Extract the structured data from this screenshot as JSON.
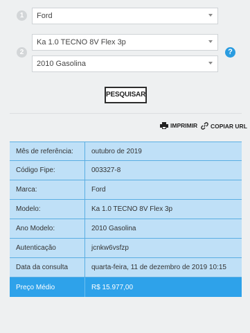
{
  "steps": [
    "1",
    "2"
  ],
  "selects": {
    "marca": "Ford",
    "modelo": "Ka 1.0 TECNO 8V Flex 3p",
    "ano": "2010 Gasolina"
  },
  "help_icon": "?",
  "search_button": "PESQUISAR",
  "actions": {
    "print_label": "IMPRIMIR",
    "copy_label": "COPIAR URL"
  },
  "results": [
    {
      "label": "Mês de referência:",
      "value": "outubro de 2019"
    },
    {
      "label": "Código Fipe:",
      "value": "003327-8"
    },
    {
      "label": "Marca:",
      "value": "Ford"
    },
    {
      "label": "Modelo:",
      "value": "Ka 1.0 TECNO 8V Flex 3p"
    },
    {
      "label": "Ano Modelo:",
      "value": "2010 Gasolina"
    },
    {
      "label": "Autenticação",
      "value": "jcnkw6vsfzp"
    },
    {
      "label": "Data da consulta",
      "value": "quarta-feira, 11 de dezembro de 2019 10:15"
    }
  ],
  "price": {
    "label": "Preço Médio",
    "value": "R$ 15.977,00"
  },
  "colors": {
    "accent": "#2ea2ea",
    "row_bg": "#bfe0f7",
    "border": "#5aaee2"
  }
}
